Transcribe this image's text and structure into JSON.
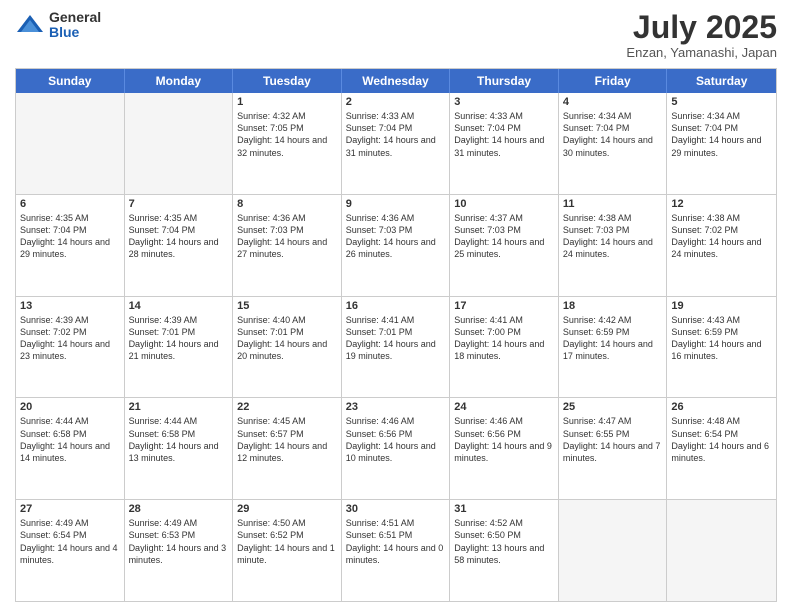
{
  "logo": {
    "general": "General",
    "blue": "Blue"
  },
  "title": "July 2025",
  "location": "Enzan, Yamanashi, Japan",
  "weekdays": [
    "Sunday",
    "Monday",
    "Tuesday",
    "Wednesday",
    "Thursday",
    "Friday",
    "Saturday"
  ],
  "weeks": [
    [
      {
        "day": "",
        "empty": true
      },
      {
        "day": "",
        "empty": true
      },
      {
        "day": "1",
        "sunrise": "4:32 AM",
        "sunset": "7:05 PM",
        "daylight": "14 hours and 32 minutes."
      },
      {
        "day": "2",
        "sunrise": "4:33 AM",
        "sunset": "7:04 PM",
        "daylight": "14 hours and 31 minutes."
      },
      {
        "day": "3",
        "sunrise": "4:33 AM",
        "sunset": "7:04 PM",
        "daylight": "14 hours and 31 minutes."
      },
      {
        "day": "4",
        "sunrise": "4:34 AM",
        "sunset": "7:04 PM",
        "daylight": "14 hours and 30 minutes."
      },
      {
        "day": "5",
        "sunrise": "4:34 AM",
        "sunset": "7:04 PM",
        "daylight": "14 hours and 29 minutes."
      }
    ],
    [
      {
        "day": "6",
        "sunrise": "4:35 AM",
        "sunset": "7:04 PM",
        "daylight": "14 hours and 29 minutes."
      },
      {
        "day": "7",
        "sunrise": "4:35 AM",
        "sunset": "7:04 PM",
        "daylight": "14 hours and 28 minutes."
      },
      {
        "day": "8",
        "sunrise": "4:36 AM",
        "sunset": "7:03 PM",
        "daylight": "14 hours and 27 minutes."
      },
      {
        "day": "9",
        "sunrise": "4:36 AM",
        "sunset": "7:03 PM",
        "daylight": "14 hours and 26 minutes."
      },
      {
        "day": "10",
        "sunrise": "4:37 AM",
        "sunset": "7:03 PM",
        "daylight": "14 hours and 25 minutes."
      },
      {
        "day": "11",
        "sunrise": "4:38 AM",
        "sunset": "7:03 PM",
        "daylight": "14 hours and 24 minutes."
      },
      {
        "day": "12",
        "sunrise": "4:38 AM",
        "sunset": "7:02 PM",
        "daylight": "14 hours and 24 minutes."
      }
    ],
    [
      {
        "day": "13",
        "sunrise": "4:39 AM",
        "sunset": "7:02 PM",
        "daylight": "14 hours and 23 minutes."
      },
      {
        "day": "14",
        "sunrise": "4:39 AM",
        "sunset": "7:01 PM",
        "daylight": "14 hours and 21 minutes."
      },
      {
        "day": "15",
        "sunrise": "4:40 AM",
        "sunset": "7:01 PM",
        "daylight": "14 hours and 20 minutes."
      },
      {
        "day": "16",
        "sunrise": "4:41 AM",
        "sunset": "7:01 PM",
        "daylight": "14 hours and 19 minutes."
      },
      {
        "day": "17",
        "sunrise": "4:41 AM",
        "sunset": "7:00 PM",
        "daylight": "14 hours and 18 minutes."
      },
      {
        "day": "18",
        "sunrise": "4:42 AM",
        "sunset": "6:59 PM",
        "daylight": "14 hours and 17 minutes."
      },
      {
        "day": "19",
        "sunrise": "4:43 AM",
        "sunset": "6:59 PM",
        "daylight": "14 hours and 16 minutes."
      }
    ],
    [
      {
        "day": "20",
        "sunrise": "4:44 AM",
        "sunset": "6:58 PM",
        "daylight": "14 hours and 14 minutes."
      },
      {
        "day": "21",
        "sunrise": "4:44 AM",
        "sunset": "6:58 PM",
        "daylight": "14 hours and 13 minutes."
      },
      {
        "day": "22",
        "sunrise": "4:45 AM",
        "sunset": "6:57 PM",
        "daylight": "14 hours and 12 minutes."
      },
      {
        "day": "23",
        "sunrise": "4:46 AM",
        "sunset": "6:56 PM",
        "daylight": "14 hours and 10 minutes."
      },
      {
        "day": "24",
        "sunrise": "4:46 AM",
        "sunset": "6:56 PM",
        "daylight": "14 hours and 9 minutes."
      },
      {
        "day": "25",
        "sunrise": "4:47 AM",
        "sunset": "6:55 PM",
        "daylight": "14 hours and 7 minutes."
      },
      {
        "day": "26",
        "sunrise": "4:48 AM",
        "sunset": "6:54 PM",
        "daylight": "14 hours and 6 minutes."
      }
    ],
    [
      {
        "day": "27",
        "sunrise": "4:49 AM",
        "sunset": "6:54 PM",
        "daylight": "14 hours and 4 minutes."
      },
      {
        "day": "28",
        "sunrise": "4:49 AM",
        "sunset": "6:53 PM",
        "daylight": "14 hours and 3 minutes."
      },
      {
        "day": "29",
        "sunrise": "4:50 AM",
        "sunset": "6:52 PM",
        "daylight": "14 hours and 1 minute."
      },
      {
        "day": "30",
        "sunrise": "4:51 AM",
        "sunset": "6:51 PM",
        "daylight": "14 hours and 0 minutes."
      },
      {
        "day": "31",
        "sunrise": "4:52 AM",
        "sunset": "6:50 PM",
        "daylight": "13 hours and 58 minutes."
      },
      {
        "day": "",
        "empty": true
      },
      {
        "day": "",
        "empty": true
      }
    ]
  ]
}
